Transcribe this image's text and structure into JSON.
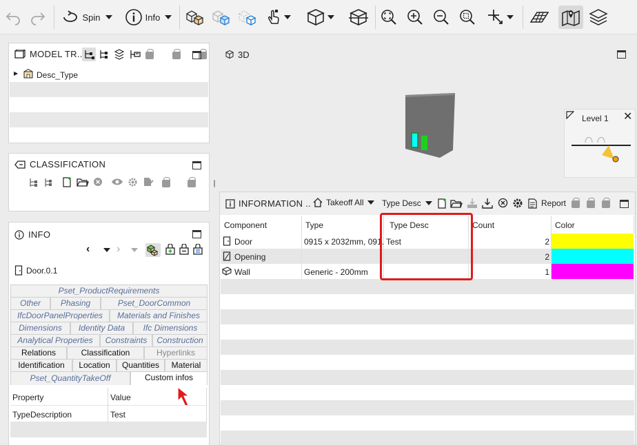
{
  "toolbar": {
    "spin_label": "Spin",
    "info_label": "Info"
  },
  "model_tree": {
    "title": "MODEL TR..",
    "root_label": "Desc_Type"
  },
  "classification": {
    "title": "CLASSIFICATION"
  },
  "info": {
    "title": "INFO",
    "element_name": "Door.0.1",
    "tab_rows": [
      [
        {
          "label": "Pset_ProductRequirements",
          "style": "it"
        }
      ],
      [
        {
          "label": "Other",
          "style": "it"
        },
        {
          "label": "Phasing",
          "style": "it"
        },
        {
          "label": "Pset_DoorCommon",
          "style": "it"
        }
      ],
      [
        {
          "label": "IfcDoorPanelProperties",
          "style": "it"
        },
        {
          "label": "Materials and Finishes",
          "style": "it"
        }
      ],
      [
        {
          "label": "Dimensions",
          "style": "it"
        },
        {
          "label": "Identity Data",
          "style": "it"
        },
        {
          "label": "Ifc Dimensions",
          "style": "it"
        }
      ],
      [
        {
          "label": "Analytical Properties",
          "style": "it"
        },
        {
          "label": "Constraints",
          "style": "it"
        },
        {
          "label": "Construction",
          "style": "it"
        }
      ],
      [
        {
          "label": "Relations",
          "style": "plain"
        },
        {
          "label": "Classification",
          "style": "plain"
        },
        {
          "label": "Hyperlinks",
          "style": "dim"
        }
      ],
      [
        {
          "label": "Identification",
          "style": "plain"
        },
        {
          "label": "Location",
          "style": "plain"
        },
        {
          "label": "Quantities",
          "style": "plain"
        },
        {
          "label": "Material",
          "style": "plain"
        }
      ],
      [
        {
          "label": "Pset_QuantityTakeOff",
          "style": "it"
        },
        {
          "label": "Custom infos",
          "style": "active"
        }
      ]
    ],
    "prop_headers": {
      "property": "Property",
      "value": "Value"
    },
    "prop_rows": [
      {
        "property": "TypeDescription",
        "value": "Test"
      }
    ]
  },
  "viewport": {
    "title": "3D",
    "level_label": "Level 1"
  },
  "information": {
    "title": "INFORMATION ..",
    "takeoff_label": "Takeoff All",
    "type_desc_label": "Type Desc",
    "report_label": "Report",
    "columns": [
      "Component",
      "Type",
      "Type Desc",
      "Count",
      "Color"
    ],
    "rows": [
      {
        "component": "Door",
        "type": "0915 x 2032mm, 091..",
        "type_desc": "Test",
        "count": "2",
        "color": "#ffff00"
      },
      {
        "component": "Opening",
        "type": "",
        "type_desc": "",
        "count": "2",
        "color": "#00ffff"
      },
      {
        "component": "Wall",
        "type": "Generic - 200mm",
        "type_desc": "",
        "count": "1",
        "color": "#ff00ff"
      }
    ]
  },
  "colors": {
    "highlight_box": "#e01b1b",
    "cursor_arrow": "#e01b1b"
  }
}
